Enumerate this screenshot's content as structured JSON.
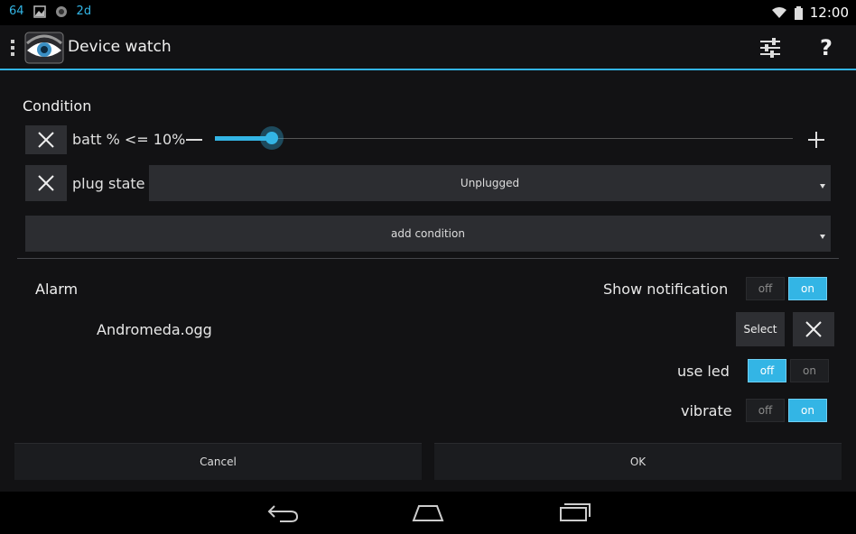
{
  "status_bar": {
    "left_icons": [
      "sim-icon",
      "image-icon",
      "record-icon",
      "app-icon"
    ],
    "left_text": [
      "64",
      "",
      "",
      "2d"
    ],
    "time": "12:00"
  },
  "action_bar": {
    "title": "Device watch",
    "icons": [
      "settings-sliders-icon",
      "help-icon"
    ],
    "help_glyph": "?"
  },
  "condition": {
    "heading": "Condition",
    "rows": [
      {
        "label": "batt % <= 10%",
        "type": "slider",
        "value": 10
      },
      {
        "label": "plug state",
        "type": "spinner",
        "selected": "Unplugged"
      }
    ],
    "add_condition": "add condition"
  },
  "alarm": {
    "heading": "Alarm",
    "show_notification": {
      "label": "Show notification",
      "off": "off",
      "on": "on",
      "state": "on"
    },
    "sound_file": "Andromeda.ogg",
    "select_label": "Select",
    "use_led": {
      "label": "use led",
      "off": "off",
      "on": "on",
      "state": "off"
    },
    "vibrate": {
      "label": "vibrate",
      "off": "off",
      "on": "on",
      "state": "on"
    }
  },
  "buttons": {
    "cancel": "Cancel",
    "ok": "OK"
  },
  "accent_color": "#33b5e5",
  "nav_icons": [
    "back-icon",
    "home-icon",
    "recents-icon"
  ]
}
